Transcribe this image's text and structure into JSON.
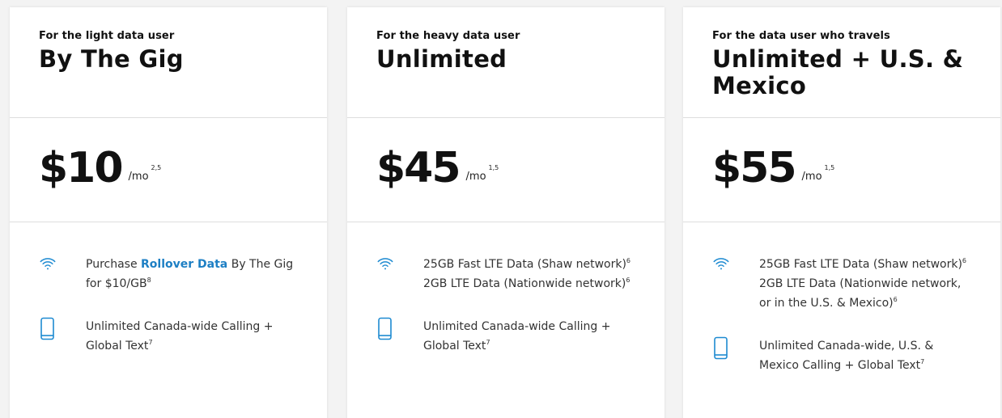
{
  "plans": [
    {
      "eyebrow": "For the light data user",
      "name": "By The Gig",
      "price": "$10",
      "per": "/mo",
      "per_sup": "2,5",
      "features": {
        "data": {
          "pre": "Purchase ",
          "link": "Rollover Data",
          "post": " By The Gig for $10/GB",
          "sup": "8"
        },
        "calling": {
          "text": "Unlimited Canada-wide Calling + Global Text",
          "sup": "7"
        }
      }
    },
    {
      "eyebrow": "For the heavy data user",
      "name": "Unlimited",
      "price": "$45",
      "per": "/mo",
      "per_sup": "1,5",
      "features": {
        "data": {
          "line1": "25GB Fast LTE Data (Shaw network)",
          "line1_sup": "6",
          "line2": "2GB LTE Data (Nationwide network)",
          "line2_sup": "6"
        },
        "calling": {
          "text": "Unlimited Canada-wide Calling + Global Text",
          "sup": "7"
        }
      }
    },
    {
      "eyebrow": "For the data user who travels",
      "name": "Unlimited + U.S. & Mexico",
      "price": "$55",
      "per": "/mo",
      "per_sup": "1,5",
      "features": {
        "data": {
          "line1": "25GB Fast LTE Data (Shaw network)",
          "line1_sup": "6",
          "line2": "2GB LTE Data (Nationwide network, or in the U.S. & Mexico)",
          "line2_sup": "6"
        },
        "calling": {
          "text": "Unlimited Canada-wide, U.S. & Mexico Calling + Global Text",
          "sup": "7"
        }
      }
    }
  ],
  "icons": {
    "data": "wifi-icon",
    "calling": "smartphone-icon"
  },
  "colors": {
    "accent": "#1d8ad1",
    "link": "#1d7fc4",
    "divider": "#dedede",
    "background": "#f3f3f3"
  }
}
